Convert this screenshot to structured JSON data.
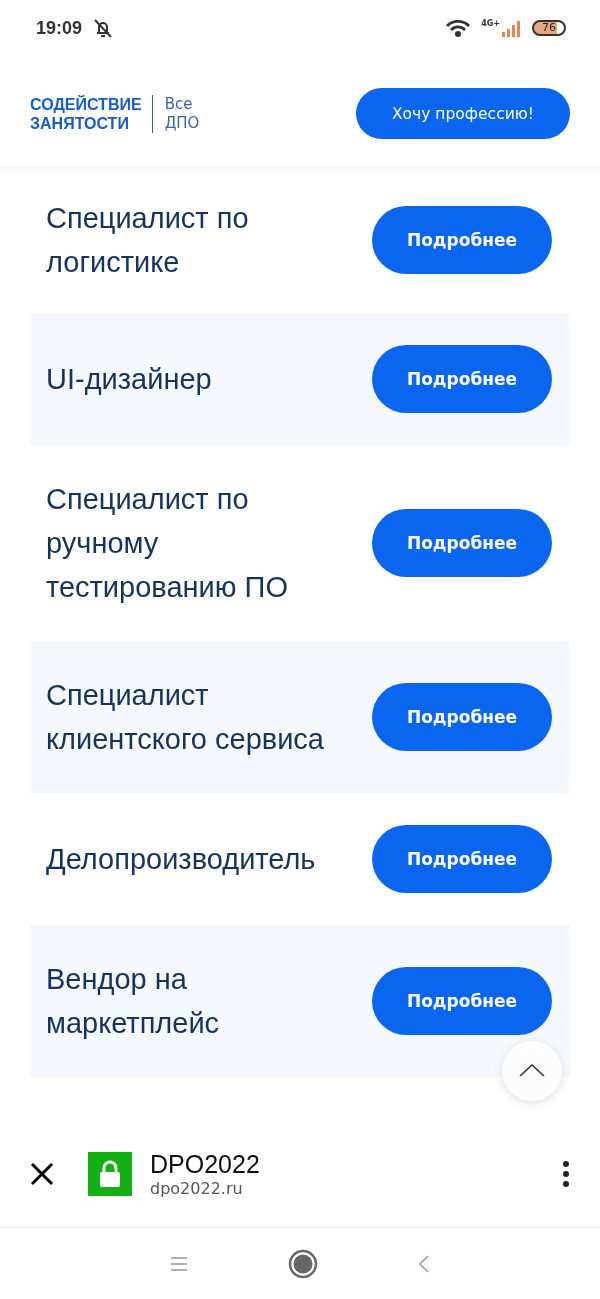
{
  "status_bar": {
    "time": "19:09",
    "network": "4G+",
    "battery": "76"
  },
  "header": {
    "logo_line_1": "СОДЕЙСТВИЕ",
    "logo_line_2": "ЗАНЯТОСТИ",
    "section_line_1": "Все",
    "section_line_2": "ДПО",
    "cta_button": "Хочу профессию!"
  },
  "professions": [
    {
      "title": "Специалист по логистике",
      "button": "Подробнее"
    },
    {
      "title": "UI-дизайнер",
      "button": "Подробнее"
    },
    {
      "title": "Специалист по ручному тестированию ПО",
      "button": "Подробнее"
    },
    {
      "title": "Специалист клиентского сервиса",
      "button": "Подробнее"
    },
    {
      "title": "Делопроизводитель",
      "button": "Подробнее"
    },
    {
      "title": "Вендор на маркетплейс",
      "button": "Подробнее"
    }
  ],
  "browser_bar": {
    "site_title": "DPO2022",
    "url": "dpo2022.ru"
  }
}
